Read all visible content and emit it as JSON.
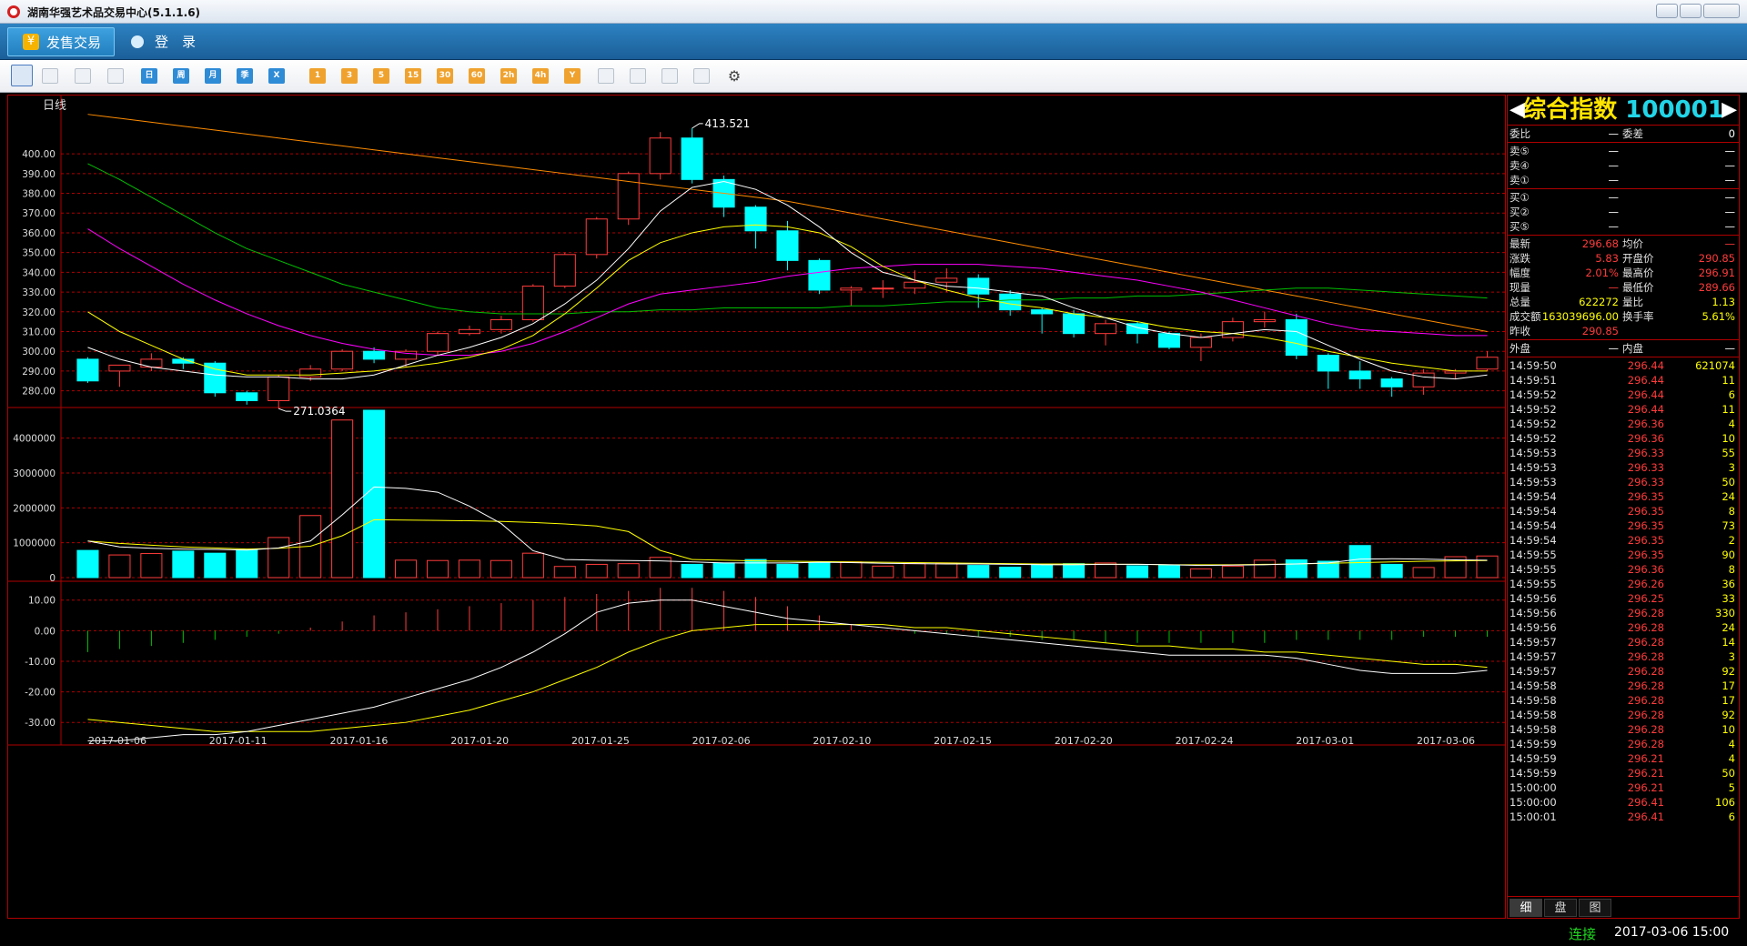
{
  "window": {
    "title": "湖南华强艺术品交易中心(5.1.1.6)"
  },
  "menu": {
    "items": [
      {
        "label": "发售交易",
        "icon": "yen-icon"
      },
      {
        "label": "登　录",
        "icon": "user-icon"
      }
    ]
  },
  "toolbar": {
    "buttons": [
      "chart-type",
      "line-chart",
      "candle",
      "calendar",
      "日",
      "周",
      "月",
      "季",
      "X",
      "1",
      "3",
      "5",
      "15",
      "30",
      "60",
      "2h",
      "4h",
      "Y",
      "draw",
      "zoom-in",
      "zoom-out",
      "edit",
      "settings"
    ]
  },
  "chart": {
    "period_label": "日线",
    "y_ticks": [
      "400.00",
      "390.00",
      "380.00",
      "370.00",
      "360.00",
      "350.00",
      "340.00",
      "330.00",
      "320.00",
      "310.00",
      "300.00",
      "290.00",
      "280.00"
    ],
    "vol_ticks": [
      "4000000",
      "3000000",
      "2000000",
      "1000000",
      "0"
    ],
    "macd_ticks": [
      "10.00",
      "0.00",
      "-10.00",
      "-20.00",
      "-30.00"
    ],
    "x_labels": [
      "2017-01-06",
      "2017-01-11",
      "2017-01-16",
      "2017-01-20",
      "2017-01-25",
      "2017-02-06",
      "2017-02-10",
      "2017-02-15",
      "2017-02-20",
      "2017-02-24",
      "2017-03-01",
      "2017-03-06"
    ],
    "max_label": "413.521",
    "min_label": "271.0364"
  },
  "chart_data": {
    "type": "candlestick",
    "ylim": [
      272,
      424
    ],
    "candles": [
      [
        296,
        285,
        297,
        284
      ],
      [
        290,
        293,
        292,
        282
      ],
      [
        292,
        296,
        299,
        290
      ],
      [
        296,
        294,
        297,
        291
      ],
      [
        294,
        279,
        295,
        277
      ],
      [
        279,
        275,
        280,
        273
      ],
      [
        275,
        287,
        288,
        271
      ],
      [
        287,
        291,
        293,
        285
      ],
      [
        291,
        300,
        301,
        290
      ],
      [
        300,
        296,
        302,
        294
      ],
      [
        296,
        300,
        301,
        292
      ],
      [
        300,
        309,
        310,
        298
      ],
      [
        309,
        311,
        313,
        308
      ],
      [
        311,
        316,
        318,
        309
      ],
      [
        316,
        333,
        334,
        315
      ],
      [
        333,
        349,
        350,
        332
      ],
      [
        349,
        367,
        368,
        347
      ],
      [
        367,
        390,
        391,
        364
      ],
      [
        390,
        408,
        411,
        387
      ],
      [
        408,
        387,
        413,
        385
      ],
      [
        387,
        373,
        389,
        368
      ],
      [
        373,
        361,
        374,
        352
      ],
      [
        361,
        346,
        366,
        341
      ],
      [
        346,
        331,
        347,
        329
      ],
      [
        331,
        332,
        333,
        323
      ],
      [
        332,
        332,
        336,
        327
      ],
      [
        332,
        335,
        341,
        329
      ],
      [
        335,
        337,
        342,
        330
      ],
      [
        337,
        329,
        339,
        322
      ],
      [
        329,
        321,
        331,
        318
      ],
      [
        321,
        319,
        322,
        309
      ],
      [
        319,
        309,
        321,
        307
      ],
      [
        309,
        314,
        316,
        303
      ],
      [
        314,
        309,
        315,
        304
      ],
      [
        309,
        302,
        310,
        301
      ],
      [
        302,
        307,
        309,
        295
      ],
      [
        307,
        315,
        317,
        305
      ],
      [
        315,
        316,
        320,
        312
      ],
      [
        316,
        298,
        319,
        296
      ],
      [
        298,
        290,
        299,
        281
      ],
      [
        290,
        286,
        295,
        281
      ],
      [
        286,
        282,
        287,
        277
      ],
      [
        282,
        289,
        291,
        278
      ],
      [
        289,
        290,
        291,
        286
      ],
      [
        291,
        297,
        300,
        290
      ]
    ],
    "ma_white": [
      302,
      296,
      292,
      290,
      288,
      287,
      287,
      286,
      286,
      288,
      293,
      298,
      302,
      307,
      314,
      324,
      336,
      352,
      371,
      383,
      386,
      382,
      374,
      363,
      350,
      340,
      336,
      333,
      332,
      330,
      328,
      322,
      317,
      312,
      309,
      307,
      309,
      311,
      310,
      303,
      296,
      290,
      287,
      286,
      288
    ],
    "ma_yellow": [
      320,
      310,
      303,
      296,
      291,
      288,
      288,
      288,
      289,
      290,
      292,
      294,
      297,
      301,
      308,
      319,
      332,
      346,
      355,
      360,
      363,
      364,
      363,
      360,
      353,
      343,
      336,
      331,
      327,
      324,
      322,
      319,
      317,
      315,
      312,
      310,
      309,
      307,
      304,
      300,
      297,
      294,
      292,
      290,
      290
    ],
    "ma_magenta": [
      362,
      352,
      343,
      334,
      326,
      319,
      313,
      308,
      304,
      301,
      299,
      298,
      298,
      300,
      304,
      310,
      317,
      324,
      329,
      331,
      333,
      335,
      338,
      340,
      342,
      343,
      344,
      344,
      344,
      343,
      342,
      340,
      338,
      336,
      333,
      330,
      326,
      322,
      318,
      314,
      311,
      310,
      309,
      308,
      308
    ],
    "ma_green": [
      395,
      387,
      378,
      369,
      360,
      352,
      346,
      340,
      334,
      330,
      326,
      322,
      320,
      319,
      319,
      319,
      320,
      320,
      321,
      321,
      322,
      322,
      322,
      322,
      323,
      323,
      324,
      325,
      325,
      326,
      326,
      327,
      327,
      328,
      328,
      329,
      330,
      331,
      332,
      332,
      331,
      330,
      329,
      328,
      327
    ],
    "ma_orange": [
      420,
      418,
      416,
      414,
      412,
      410,
      408,
      406,
      404,
      402,
      400,
      398,
      396,
      394,
      392,
      390,
      388,
      386,
      384,
      382,
      380,
      378,
      376,
      373,
      370,
      367,
      364,
      361,
      358,
      355,
      352,
      349,
      346,
      343,
      340,
      337,
      334,
      331,
      328,
      325,
      322,
      319,
      316,
      313,
      310
    ],
    "volume": [
      780000,
      650000,
      690000,
      760000,
      700000,
      800000,
      1150000,
      1780000,
      4520000,
      4800000,
      500000,
      490000,
      500000,
      490000,
      700000,
      320000,
      380000,
      400000,
      580000,
      380000,
      420000,
      520000,
      380000,
      420000,
      450000,
      330000,
      400000,
      420000,
      350000,
      300000,
      380000,
      400000,
      420000,
      340000,
      360000,
      250000,
      330000,
      500000,
      510000,
      470000,
      920000,
      380000,
      290000,
      600000,
      620000
    ],
    "vol_ma_white": [
      1050000,
      880000,
      840000,
      820000,
      810000,
      790000,
      850000,
      1050000,
      1800000,
      2600000,
      2560000,
      2450000,
      2050000,
      1550000,
      770000,
      520000,
      500000,
      490000,
      480000,
      450000,
      420000,
      420000,
      420000,
      440000,
      430000,
      410000,
      400000,
      390000,
      390000,
      380000,
      370000,
      370000,
      380000,
      380000,
      370000,
      350000,
      360000,
      370000,
      390000,
      420000,
      530000,
      540000,
      530000,
      510000,
      500000
    ],
    "vol_ma_yellow": [
      1050000,
      980000,
      930000,
      880000,
      850000,
      820000,
      840000,
      900000,
      1200000,
      1660000,
      1650000,
      1640000,
      1630000,
      1610000,
      1580000,
      1540000,
      1480000,
      1320000,
      780000,
      520000,
      500000,
      480000,
      470000,
      460000,
      450000,
      440000,
      430000,
      420000,
      410000,
      400000,
      390000,
      390000,
      380000,
      380000,
      370000,
      370000,
      370000,
      380000,
      390000,
      410000,
      430000,
      450000,
      470000,
      480000,
      490000
    ],
    "macd_bar": [
      -7,
      -6,
      -5,
      -4,
      -3,
      -2,
      -1,
      1,
      3,
      5,
      6,
      7,
      8,
      9,
      10,
      11,
      12,
      13,
      14,
      14,
      13,
      11,
      8,
      5,
      2,
      0,
      -1,
      -1,
      -2,
      -2,
      -3,
      -3,
      -4,
      -4,
      -4,
      -4,
      -4,
      -4,
      -3,
      -3,
      -3,
      -3,
      -2,
      -2,
      -2
    ],
    "macd_dif": [
      -36,
      -36,
      -35,
      -34,
      -34,
      -33,
      -31,
      -29,
      -27,
      -25,
      -22,
      -19,
      -16,
      -12,
      -7,
      -1,
      6,
      9,
      10,
      10,
      8,
      6,
      4,
      3,
      2,
      1,
      0,
      -1,
      -2,
      -3,
      -4,
      -5,
      -6,
      -7,
      -8,
      -8,
      -8,
      -8,
      -9,
      -11,
      -13,
      -14,
      -14,
      -14,
      -13
    ],
    "macd_dea": [
      -29,
      -30,
      -31,
      -32,
      -33,
      -33,
      -33,
      -33,
      -32,
      -31,
      -30,
      -28,
      -26,
      -23,
      -20,
      -16,
      -12,
      -7,
      -3,
      0,
      1,
      2,
      2,
      2,
      2,
      2,
      1,
      1,
      0,
      -1,
      -2,
      -3,
      -4,
      -5,
      -5,
      -6,
      -6,
      -7,
      -7,
      -8,
      -9,
      -10,
      -11,
      -11,
      -12
    ],
    "ylim_volume": [
      0,
      4800000
    ],
    "ylim_macd": [
      -35,
      12
    ]
  },
  "panel": {
    "title": "综合指数",
    "code": "100001",
    "rows1": [
      {
        "l": "委比",
        "v": "—",
        "l2": "委差",
        "v2": "0"
      }
    ],
    "orders": [
      {
        "l": "卖⑤",
        "v": "—",
        "v2": "—"
      },
      {
        "l": "卖④",
        "v": "—",
        "v2": "—"
      },
      {
        "l": "卖①",
        "v": "—",
        "v2": "—"
      },
      {
        "l": "买①",
        "v": "—",
        "v2": "—"
      },
      {
        "l": "买②",
        "v": "—",
        "v2": "—"
      },
      {
        "l": "买⑤",
        "v": "—",
        "v2": "—"
      }
    ],
    "stats": [
      {
        "l": "最新",
        "v": "296.68",
        "l2": "均价",
        "v2": "—"
      },
      {
        "l": "涨跌",
        "v": "5.83",
        "l2": "开盘价",
        "v2": "290.85"
      },
      {
        "l": "幅度",
        "v": "2.01%",
        "l2": "最高价",
        "v2": "296.91"
      },
      {
        "l": "现量",
        "v": "—",
        "l2": "最低价",
        "v2": "289.66"
      },
      {
        "l": "总量",
        "v": "622272",
        "l2": "量比",
        "v2": "1.13"
      },
      {
        "l": "成交额",
        "v": "163039696.00",
        "l2": "换手率",
        "v2": "5.61%"
      },
      {
        "l": "昨收",
        "v": "290.85",
        "l2": "",
        "v2": ""
      }
    ],
    "trade_header": {
      "l": "外盘",
      "v": "—",
      "l2": "内盘",
      "v2": "—"
    },
    "trades": [
      [
        "14:59:50",
        "296.44",
        "621074"
      ],
      [
        "14:59:51",
        "296.44",
        "11"
      ],
      [
        "14:59:52",
        "296.44",
        "6"
      ],
      [
        "14:59:52",
        "296.44",
        "11"
      ],
      [
        "14:59:52",
        "296.36",
        "4"
      ],
      [
        "14:59:52",
        "296.36",
        "10"
      ],
      [
        "14:59:53",
        "296.33",
        "55"
      ],
      [
        "14:59:53",
        "296.33",
        "3"
      ],
      [
        "14:59:53",
        "296.33",
        "50"
      ],
      [
        "14:59:54",
        "296.35",
        "24"
      ],
      [
        "14:59:54",
        "296.35",
        "8"
      ],
      [
        "14:59:54",
        "296.35",
        "73"
      ],
      [
        "14:59:54",
        "296.35",
        "2"
      ],
      [
        "14:59:55",
        "296.35",
        "90"
      ],
      [
        "14:59:55",
        "296.36",
        "8"
      ],
      [
        "14:59:55",
        "296.26",
        "36"
      ],
      [
        "14:59:56",
        "296.25",
        "33"
      ],
      [
        "14:59:56",
        "296.28",
        "330"
      ],
      [
        "14:59:56",
        "296.28",
        "24"
      ],
      [
        "14:59:57",
        "296.28",
        "14"
      ],
      [
        "14:59:57",
        "296.28",
        "3"
      ],
      [
        "14:59:57",
        "296.28",
        "92"
      ],
      [
        "14:59:58",
        "296.28",
        "17"
      ],
      [
        "14:59:58",
        "296.28",
        "17"
      ],
      [
        "14:59:58",
        "296.28",
        "92"
      ],
      [
        "14:59:58",
        "296.28",
        "10"
      ],
      [
        "14:59:59",
        "296.28",
        "4"
      ],
      [
        "14:59:59",
        "296.21",
        "4"
      ],
      [
        "14:59:59",
        "296.21",
        "50"
      ],
      [
        "15:00:00",
        "296.21",
        "5"
      ],
      [
        "15:00:00",
        "296.41",
        "106"
      ],
      [
        "15:00:01",
        "296.41",
        "6"
      ]
    ],
    "tabs": [
      "细",
      "盘",
      "图"
    ]
  },
  "status": {
    "connection": "连接",
    "datetime": "2017-03-06 15:00"
  },
  "colors": {
    "up": "#ff3b3b",
    "down": "#00ffff",
    "grid": "#b00000",
    "ma_white": "#ffffff",
    "ma_yellow": "#ffff00",
    "ma_magenta": "#ff00ff",
    "ma_green": "#00c000",
    "ma_orange": "#ff8c00"
  }
}
